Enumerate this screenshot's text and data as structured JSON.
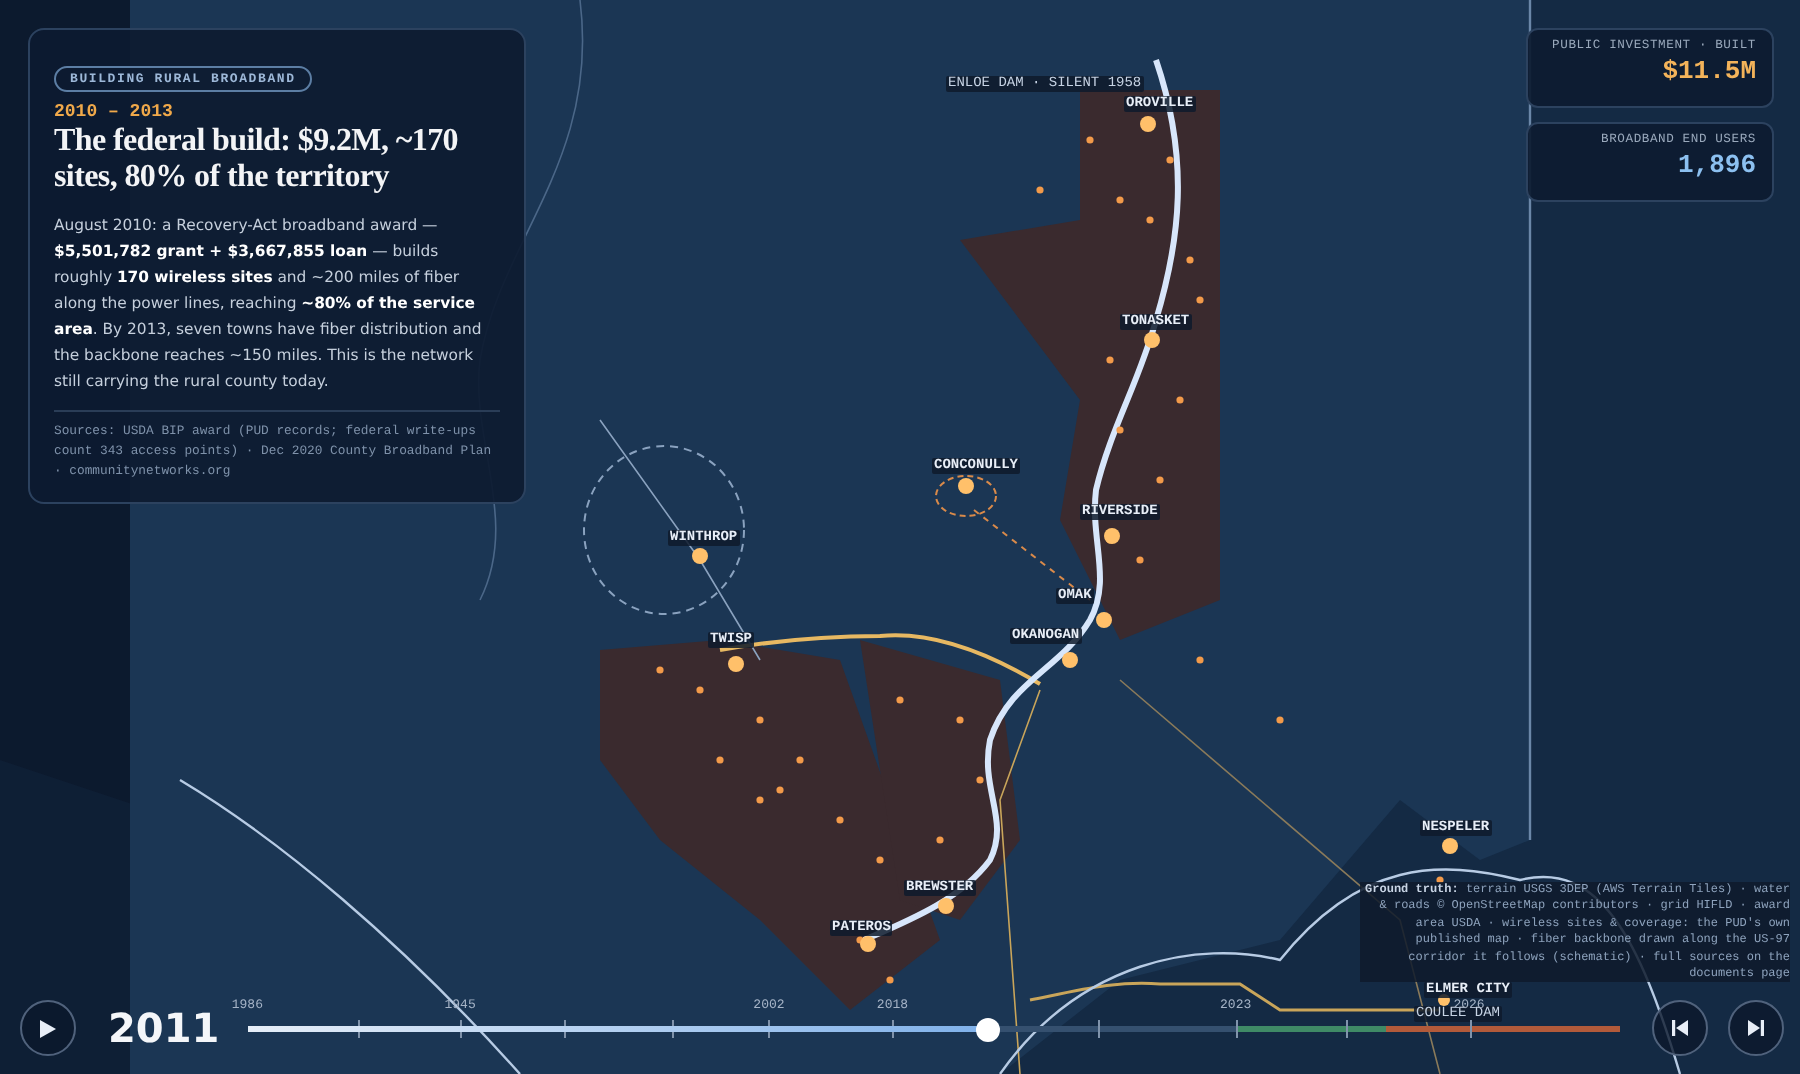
{
  "story_card": {
    "tag": "BUILDING RURAL BROADBAND",
    "years": "2010 – 2013",
    "title": "The federal build: $9.2M, ~170 sites, 80% of the territory",
    "body": "August 2010: a Recovery-Act broadband award — **$5,501,782 grant + $3,667,855 loan** — builds roughly **170 wireless sites** and ~200 miles of fiber along the power lines, reaching **~80% of the service area**. By 2013, seven towns have fiber distribution and the backbone reaches ~150 miles. This is the network still carrying the rural county today.",
    "sources": "Sources: USDA BIP award (PUD records; federal write-ups count 343 access points) · Dec 2020 County Broadband Plan · communitynetworks.org"
  },
  "stats": [
    {
      "label": "PUBLIC INVESTMENT · BUILT",
      "value": "$11.5M",
      "color": "#f3b35a"
    },
    {
      "label": "BROADBAND END USERS",
      "value": "1,896",
      "color": "#8cc0f0"
    }
  ],
  "map": {
    "labels": [
      {
        "text": "ENLOE DAM · SILENT 1958",
        "kind": "note"
      },
      {
        "text": "OROVILLE",
        "kind": "town"
      },
      {
        "text": "TONASKET",
        "kind": "town"
      },
      {
        "text": "CONCONULLY",
        "kind": "town"
      },
      {
        "text": "RIVERSIDE",
        "kind": "town"
      },
      {
        "text": "OMAK",
        "kind": "town"
      },
      {
        "text": "OKANOGAN",
        "kind": "town"
      },
      {
        "text": "WINTHROP",
        "kind": "town"
      },
      {
        "text": "TWISP",
        "kind": "town"
      },
      {
        "text": "BREWSTER",
        "kind": "town"
      },
      {
        "text": "PATEROS",
        "kind": "town"
      },
      {
        "text": "NESPELER",
        "kind": "town"
      },
      {
        "text": "ELMER CITY",
        "kind": "town"
      },
      {
        "text": "COULEE DAM",
        "kind": "note"
      }
    ],
    "ground_truth_label": "Ground truth:",
    "ground_truth": "terrain USGS 3DEP (AWS Terrain Tiles) · water & roads © OpenStreetMap contributors · grid HIFLD · award area USDA · wireless sites & coverage: the PUD's own published map · fiber backbone drawn along the US-97 corridor it follows (schematic) · full sources on the documents page"
  },
  "timeline": {
    "year": "2011",
    "level": 0.54,
    "ticks": [
      "1986",
      "1945",
      "2002",
      "2018",
      "2023",
      "2026"
    ]
  }
}
